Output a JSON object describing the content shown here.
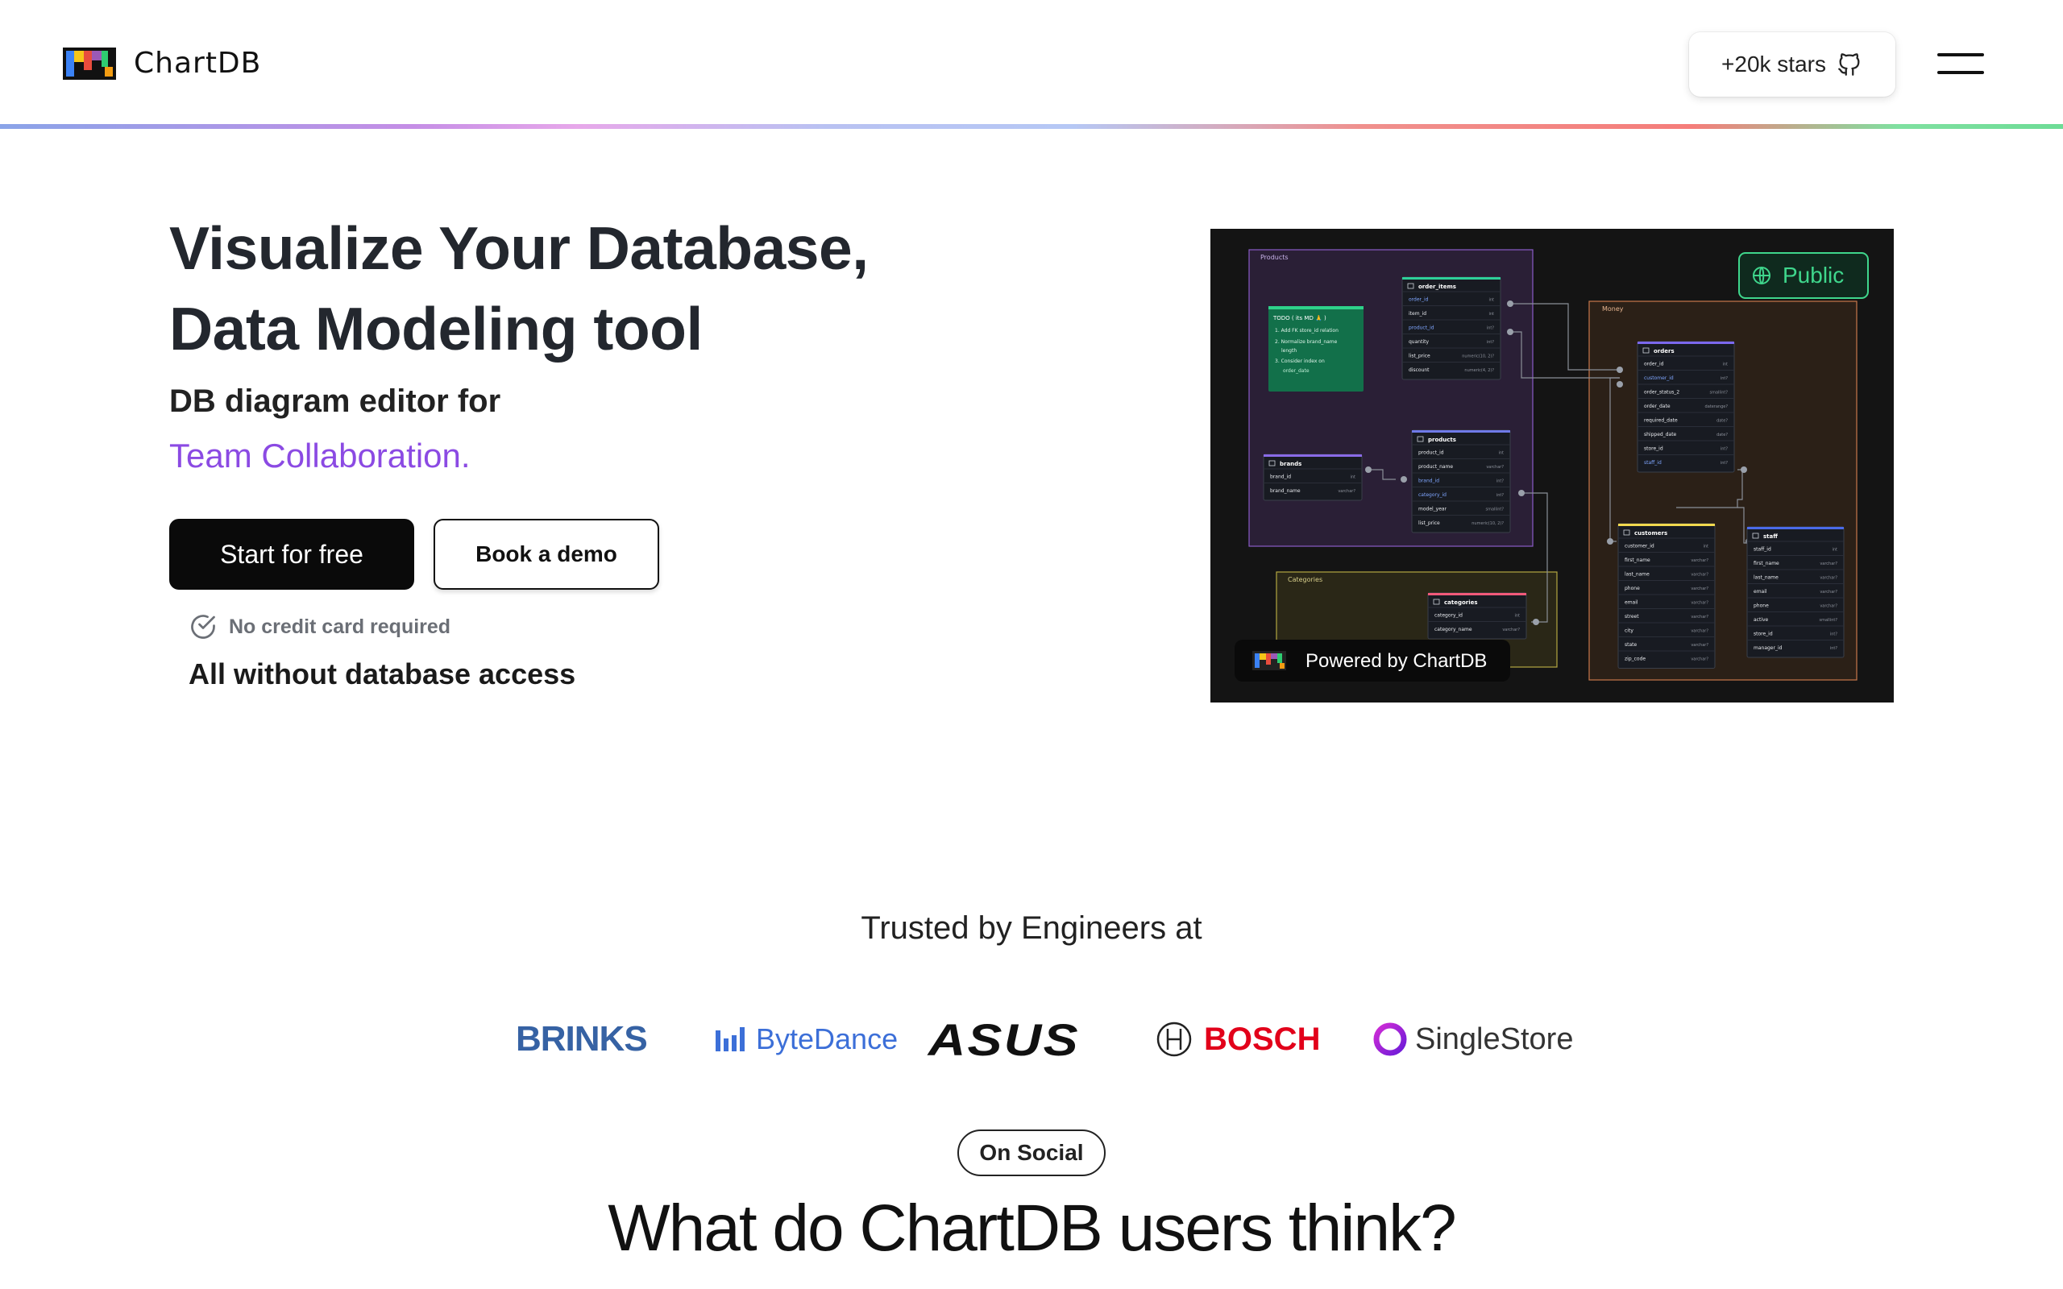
{
  "header": {
    "logo_text": "ChartDB",
    "stars_label": "+20k stars",
    "menu_icon": "hamburger-icon",
    "github_icon": "github-icon"
  },
  "hero": {
    "title_line1": "Visualize Your Database,",
    "title_line2": "Data Modeling tool",
    "subtitle": "DB diagram editor for",
    "accent": "Team Collaboration.",
    "start_button": "Start for free",
    "demo_button": "Book a demo",
    "no_credit_card": "No credit card required",
    "no_db_access": "All without database access"
  },
  "preview": {
    "public_label": "Public",
    "powered_by": "Powered by ChartDB",
    "areas": {
      "products": "Products",
      "money": "Money",
      "categories": "Categories"
    },
    "todo": {
      "title": "TODO ( its MD 🙏 )",
      "item1": "1. Add FK  store_id  relation",
      "item2": "2. Normalize  brand_name",
      "item2b": "length",
      "item3": "3. Consider index on",
      "item3b": "order_date"
    },
    "tables": {
      "order_items": {
        "name": "order_items",
        "rows": [
          {
            "col": "order_id",
            "type": "int"
          },
          {
            "col": "item_id",
            "type": "int"
          },
          {
            "col": "product_id",
            "type": "int?"
          },
          {
            "col": "quantity",
            "type": "int?"
          },
          {
            "col": "list_price",
            "type": "numeric(10, 2)?"
          },
          {
            "col": "discount",
            "type": "numeric(4, 2)?"
          }
        ]
      },
      "brands": {
        "name": "brands",
        "rows": [
          {
            "col": "brand_id",
            "type": "int"
          },
          {
            "col": "brand_name",
            "type": "varchar?"
          }
        ]
      },
      "products": {
        "name": "products",
        "rows": [
          {
            "col": "product_id",
            "type": "int"
          },
          {
            "col": "product_name",
            "type": "varchar?"
          },
          {
            "col": "brand_id",
            "type": "int?"
          },
          {
            "col": "category_id",
            "type": "int?"
          },
          {
            "col": "model_year",
            "type": "smallint?"
          },
          {
            "col": "list_price",
            "type": "numeric(10, 2)?"
          }
        ]
      },
      "orders": {
        "name": "orders",
        "rows": [
          {
            "col": "order_id",
            "type": "int"
          },
          {
            "col": "customer_id",
            "type": "int?"
          },
          {
            "col": "order_status_2",
            "type": "smallint?"
          },
          {
            "col": "order_date",
            "type": "daterange?"
          },
          {
            "col": "required_date",
            "type": "date?"
          },
          {
            "col": "shipped_date",
            "type": "date?"
          },
          {
            "col": "store_id",
            "type": "int?"
          },
          {
            "col": "staff_id",
            "type": "int?"
          }
        ]
      },
      "customers": {
        "name": "customers",
        "rows": [
          {
            "col": "customer_id",
            "type": "int"
          },
          {
            "col": "first_name",
            "type": "varchar?"
          },
          {
            "col": "last_name",
            "type": "varchar?"
          },
          {
            "col": "phone",
            "type": "varchar?"
          },
          {
            "col": "email",
            "type": "varchar?"
          },
          {
            "col": "street",
            "type": "varchar?"
          },
          {
            "col": "city",
            "type": "varchar?"
          },
          {
            "col": "state",
            "type": "varchar?"
          },
          {
            "col": "zip_code",
            "type": "varchar?"
          }
        ]
      },
      "staff": {
        "name": "staff",
        "rows": [
          {
            "col": "staff_id",
            "type": "int"
          },
          {
            "col": "first_name",
            "type": "varchar?"
          },
          {
            "col": "last_name",
            "type": "varchar?"
          },
          {
            "col": "email",
            "type": "varchar?"
          },
          {
            "col": "phone",
            "type": "varchar?"
          },
          {
            "col": "active",
            "type": "smallint?"
          },
          {
            "col": "store_id",
            "type": "int?"
          },
          {
            "col": "manager_id",
            "type": "int?"
          }
        ]
      },
      "categories": {
        "name": "categories",
        "rows": [
          {
            "col": "category_id",
            "type": "int"
          },
          {
            "col": "category_name",
            "type": "varchar?"
          }
        ]
      }
    }
  },
  "trusted": {
    "heading": "Trusted by Engineers at",
    "brands": [
      "BRINKS",
      "ByteDance",
      "ASUS",
      "BOSCH",
      "SingleStore"
    ]
  },
  "social": {
    "pill": "On Social",
    "heading": "What do ChartDB users think?"
  },
  "colors": {
    "accent_purple": "#8b4ae3",
    "public_green": "#3fd68c",
    "bosch_red": "#e2001a",
    "brinks_blue": "#2c5aa0",
    "bytedance_blue": "#3c6fd8"
  }
}
